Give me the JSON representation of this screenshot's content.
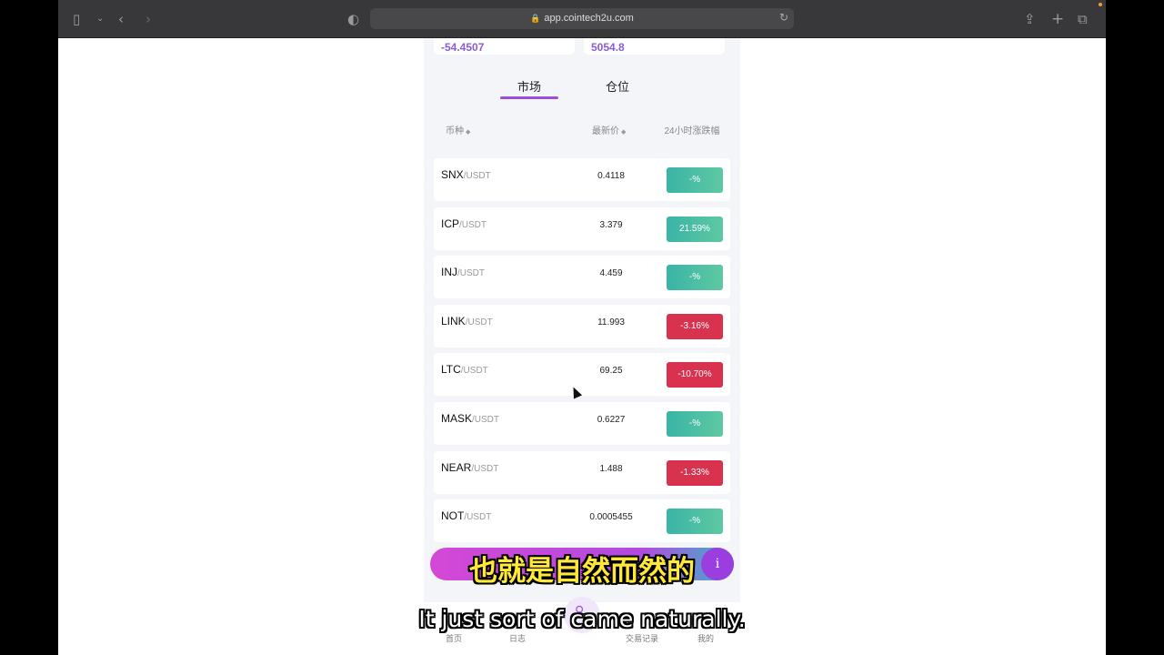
{
  "browser": {
    "url": "app.cointech2u.com",
    "icons": {
      "sidebar": "sidebar-icon",
      "chevron": "chevron-down-icon",
      "back": "back-icon",
      "forward": "forward-icon",
      "shield": "shield-icon",
      "lock": "lock-icon",
      "reload": "reload-icon",
      "share": "share-icon",
      "new_tab": "plus-icon",
      "tabs": "tabs-icon"
    }
  },
  "summary": {
    "left_value": "-54.4507",
    "right_value": "5054.8"
  },
  "tabs": {
    "market": "市场",
    "position": "仓位"
  },
  "table": {
    "headers": {
      "coin": "币种",
      "price": "最新价",
      "change": "24小时涨跌幅"
    },
    "rows": [
      {
        "symbol": "SNX",
        "quote": "/USDT",
        "price": "0.4118",
        "change": "-%",
        "trend": "up"
      },
      {
        "symbol": "ICP",
        "quote": "/USDT",
        "price": "3.379",
        "change": "21.59%",
        "trend": "up"
      },
      {
        "symbol": "INJ",
        "quote": "/USDT",
        "price": "4.459",
        "change": "-%",
        "trend": "up"
      },
      {
        "symbol": "LINK",
        "quote": "/USDT",
        "price": "11.993",
        "change": "-3.16%",
        "trend": "down"
      },
      {
        "symbol": "LTC",
        "quote": "/USDT",
        "price": "69.25",
        "change": "-10.70%",
        "trend": "down"
      },
      {
        "symbol": "MASK",
        "quote": "/USDT",
        "price": "0.6227",
        "change": "-%",
        "trend": "up"
      },
      {
        "symbol": "NEAR",
        "quote": "/USDT",
        "price": "1.488",
        "change": "-1.33%",
        "trend": "down"
      },
      {
        "symbol": "NOT",
        "quote": "/USDT",
        "price": "0.0005455",
        "change": "-%",
        "trend": "up"
      }
    ]
  },
  "floating": {
    "info_label": "i"
  },
  "bottom_nav": {
    "home": "首页",
    "log": "日志",
    "trades": "交易记录",
    "mine": "我的"
  },
  "subtitles": {
    "chinese": "也就是自然而然的",
    "english": "It just sort of came naturally."
  },
  "colors": {
    "accent": "#9b4fd6",
    "up": "#3ab4a6",
    "down": "#d8324f"
  }
}
